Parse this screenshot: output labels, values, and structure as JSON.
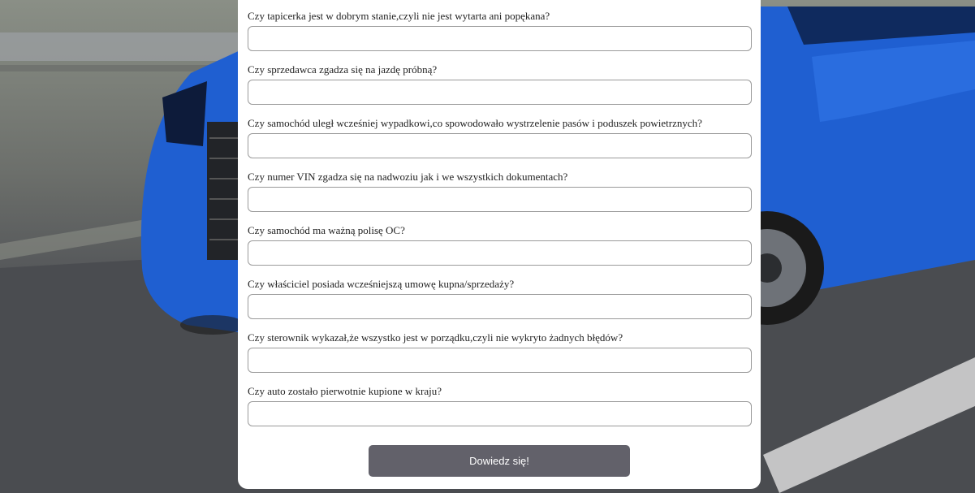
{
  "form": {
    "questions": [
      {
        "label": "Czy tapicerka jest w dobrym stanie,czyli nie jest wytarta ani popękana?",
        "value": ""
      },
      {
        "label": "Czy sprzedawca zgadza się na jazdę próbną?",
        "value": ""
      },
      {
        "label": "Czy samochód uległ wcześniej wypadkowi,co spowodowało wystrzelenie pasów i poduszek powietrznych?",
        "value": ""
      },
      {
        "label": "Czy numer VIN zgadza się na nadwoziu jak i we wszystkich dokumentach?",
        "value": ""
      },
      {
        "label": "Czy samochód ma ważną polisę OC?",
        "value": ""
      },
      {
        "label": "Czy właściciel posiada wcześniejszą umowę kupna/sprzedaży?",
        "value": ""
      },
      {
        "label": "Czy sterownik wykazał,że wszystko jest w porządku,czyli nie wykryto żadnych błędów?",
        "value": ""
      },
      {
        "label": "Czy auto zostało pierwotnie kupione w kraju?",
        "value": ""
      }
    ],
    "submit_label": "Dowiedz się!"
  },
  "colors": {
    "panel": "#ffffff",
    "button": "#62616a",
    "car": "#1f5fd1"
  }
}
